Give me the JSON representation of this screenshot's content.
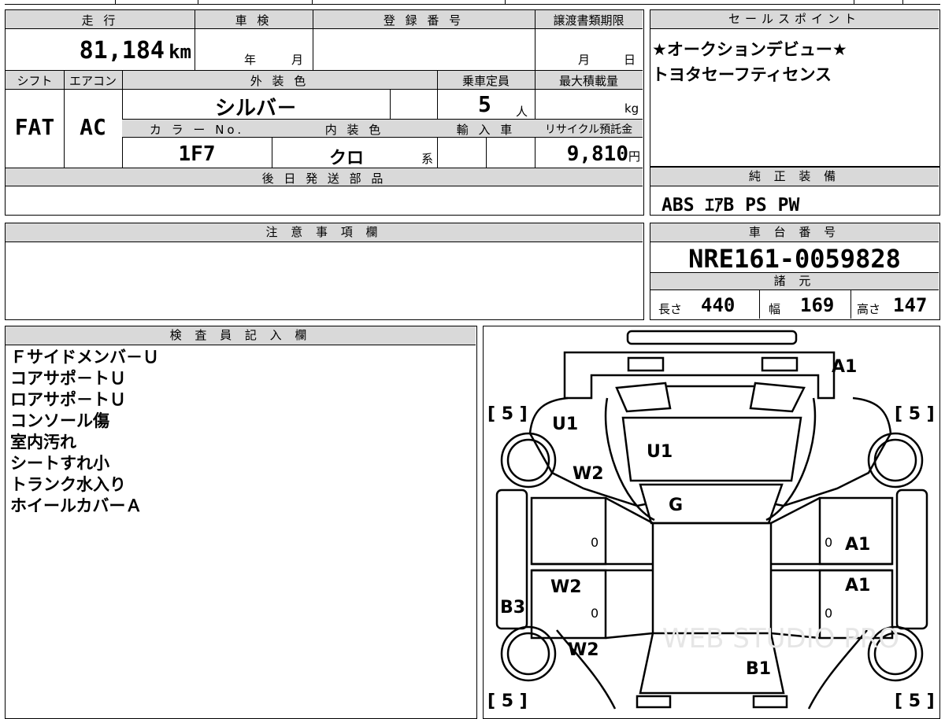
{
  "top_strip": [
    "",
    "",
    ""
  ],
  "basic": {
    "mileage_label": "走 行",
    "mileage_value": "81,184",
    "mileage_unit": "km",
    "shaken_label": "車 検",
    "shaken_year": "年",
    "shaken_month": "月",
    "registration_label": "登 録 番 号",
    "registration_value": "",
    "transfer_label": "譲渡書類期限",
    "transfer_month": "月",
    "transfer_day": "日",
    "shift_label": "シフト",
    "shift_value": "FAT",
    "aircon_label": "エアコン",
    "aircon_value": "AC",
    "exterior_label": "外 装 色",
    "exterior_value": "シルバ－",
    "capacity_label": "乗車定員",
    "capacity_value": "5",
    "capacity_unit": "人",
    "maxload_label": "最大積載量",
    "maxload_unit": "kg",
    "color_no_label": "カ ラ ー No.",
    "color_no_value": "1F7",
    "interior_label": "内 装 色",
    "interior_value": "クロ",
    "interior_suffix": "系",
    "import_label": "輸 入 車",
    "recycle_label": "リサイクル預託金",
    "recycle_value": "9,810",
    "recycle_unit": "円",
    "later_parts_label": "後 日 発 送 部 品",
    "later_parts_value": ""
  },
  "sales_points": {
    "label": "セールスポイント",
    "lines": [
      "★オークションデビュー★",
      "トヨタセーフティセンス"
    ]
  },
  "equipment": {
    "label": "純 正 装 備",
    "value": "ABS ｴｱB PS PW"
  },
  "notes": {
    "label": "注 意 事 項 欄",
    "value": ""
  },
  "chassis": {
    "label": "車 台 番 号",
    "value": "NRE161-0059828",
    "spec_label": "諸 元",
    "length_label": "長さ",
    "length_value": "440",
    "width_label": "幅",
    "width_value": "169",
    "height_label": "高さ",
    "height_value": "147"
  },
  "inspector": {
    "label": "検 査 員 記 入 欄",
    "lines": [
      "Ｆサイドメンバ－Ｕ",
      "コアサポ－トＵ",
      "ロアサポ－トＵ",
      "コンソール傷",
      "室内汚れ",
      "シートすれ小",
      "トランク水入り",
      "ホイールカバーＡ"
    ]
  },
  "diagram": {
    "tire_fl": "[ 5 ]",
    "tire_fr": "[ 5 ]",
    "tire_rl": "[ 5 ]",
    "tire_rr": "[ 5 ]",
    "bumper": "A1",
    "left_fender": "U1",
    "hood": "U1",
    "left_pillar": "W2",
    "windshield": "G",
    "left_front_door_zero": "0",
    "right_front_door_zero": "0",
    "right_front_door": "A1",
    "left_rear_door": "W2",
    "right_rear_door": "A1",
    "left_rear_door_zero": "0",
    "right_rear_door_zero": "0",
    "left_rocker": "B3",
    "left_quarter": "W2",
    "trunk": "B1",
    "watermark": "WEB STUDIO PRO"
  }
}
